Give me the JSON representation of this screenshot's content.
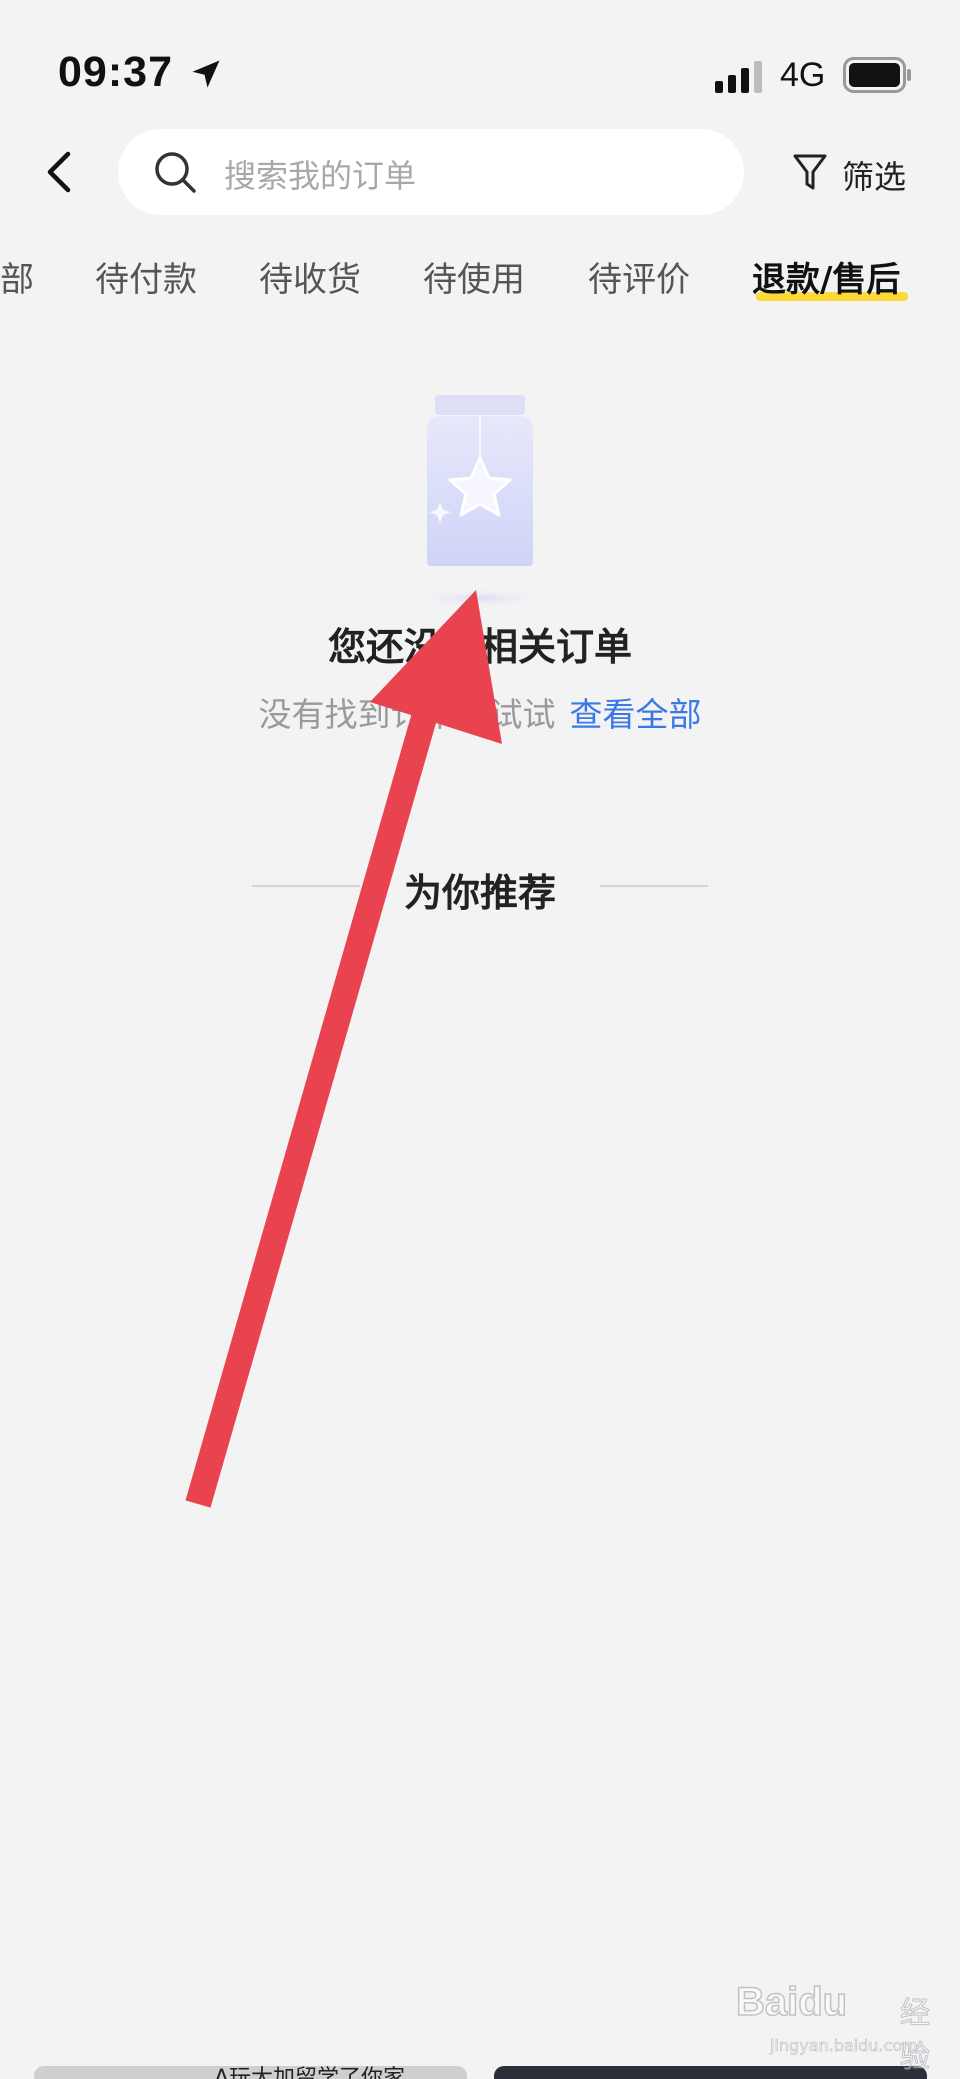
{
  "status_bar": {
    "time": "09:37",
    "network": "4G"
  },
  "header": {
    "search_placeholder": "搜索我的订单",
    "filter_label": "筛选"
  },
  "tabs": [
    {
      "label": "部",
      "active": false
    },
    {
      "label": "待付款",
      "active": false
    },
    {
      "label": "待收货",
      "active": false
    },
    {
      "label": "待使用",
      "active": false
    },
    {
      "label": "待评价",
      "active": false
    },
    {
      "label": "退款/售后",
      "active": true
    }
  ],
  "empty_state": {
    "title": "您还没有相关订单",
    "hint": "没有找到订单？试试",
    "link": "查看全部"
  },
  "recommend": {
    "title": "为你推荐"
  },
  "cards": [
    {
      "caption": "A玩大加留学了你家"
    },
    {
      "caption": ""
    }
  ],
  "watermark": {
    "logo": "Baidu",
    "text": "经验",
    "url": "jingyan.baidu.com"
  },
  "colors": {
    "accent_underline": "#ffd93a",
    "link": "#3b78e7",
    "arrow": "#e8434f",
    "background": "#f3f3f4"
  }
}
